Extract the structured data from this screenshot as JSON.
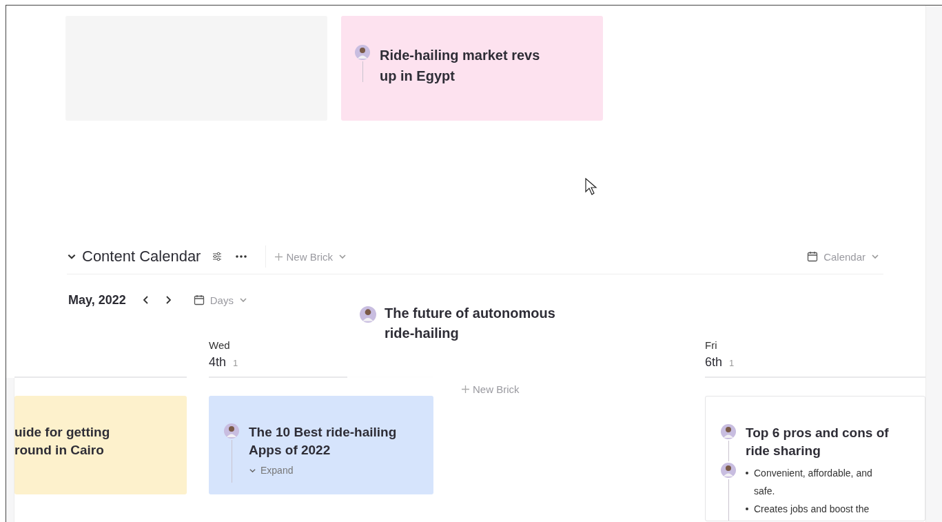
{
  "top_cards": [
    {
      "kind": "empty",
      "color": "#f5f5f5"
    },
    {
      "kind": "brick",
      "title": "Ride-hailing market revs up in Egypt",
      "color": "#fde2ef"
    }
  ],
  "section": {
    "title": "Content Calendar",
    "expanded": true,
    "new_brick": "New Brick",
    "view": "Calendar"
  },
  "toolbar": {
    "month": "May, 2022",
    "range": "Days"
  },
  "columns": [
    {
      "cards": [
        {
          "kind": "brick",
          "title": "uide for getting round in Cairo",
          "color": "#fdf1cc",
          "avatar": false
        }
      ]
    },
    {
      "weekday": "Wed",
      "date": "4th",
      "count": "1",
      "cards": [
        {
          "kind": "brick",
          "title": "The 10 Best ride-hailing Apps of 2022",
          "color": "#d6e4fc",
          "avatar": true,
          "expand": "Expand"
        }
      ]
    },
    {
      "cards": [
        {
          "kind": "new",
          "label": "New Brick"
        }
      ]
    },
    {
      "weekday": "Fri",
      "date": "6th",
      "count": "1",
      "cards": [
        {
          "kind": "brick",
          "title": "Top 6 pros and cons of ride sharing",
          "color": "#ffffff",
          "avatar": true,
          "bullets": [
            "Convenient, affordable, and safe.",
            "Creates jobs and boost the"
          ]
        }
      ]
    }
  ],
  "dragging": {
    "title": "The future of autonomous ride-hailing"
  }
}
